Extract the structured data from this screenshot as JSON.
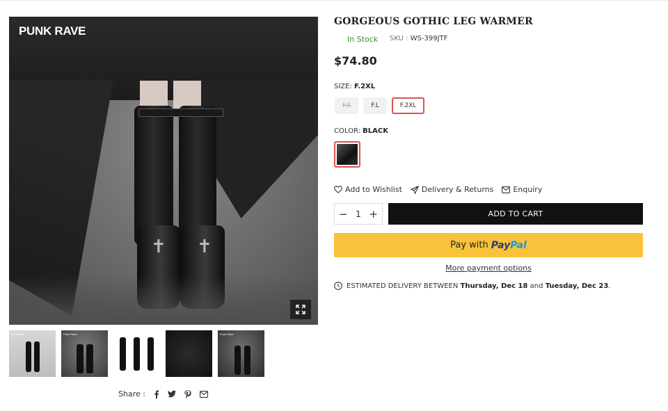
{
  "gallery": {
    "brand": "PUNK RAVE",
    "thumb_mini_labels": [
      "PunkRave",
      "Punk Rave",
      "",
      "",
      "Punk Rave"
    ]
  },
  "share": {
    "label": "Share :"
  },
  "product": {
    "title": "GORGEOUS GOTHIC LEG WARMER",
    "stock": "In Stock",
    "sku_label": "SKU :",
    "sku_value": "WS-399JTF",
    "price": "$74.80"
  },
  "size": {
    "label": "SIZE:",
    "selected": "F.2XL",
    "options": [
      {
        "label": "F.S",
        "state": "disabled"
      },
      {
        "label": "F.L",
        "state": "normal"
      },
      {
        "label": "F.2XL",
        "state": "selected"
      }
    ]
  },
  "color": {
    "label": "COLOR:",
    "selected": "BLACK"
  },
  "actions": {
    "wishlist": "Add to Wishlist",
    "delivery_returns": "Delivery & Returns",
    "enquiry": "Enquiry"
  },
  "quantity": {
    "value": "1",
    "minus": "−",
    "plus": "+"
  },
  "buttons": {
    "add_to_cart": "ADD TO CART",
    "paypal_prefix": "Pay with",
    "paypal_pay": "Pay",
    "paypal_pal": "Pal",
    "more_payment": "More payment options"
  },
  "delivery": {
    "prefix": "ESTIMATED DELIVERY BETWEEN",
    "from": "Thursday, Dec 18",
    "and": "and",
    "to": "Tuesday, Dec 23",
    "suffix": "."
  },
  "colors": {
    "accent_red": "#d9534f",
    "in_stock_green": "#3a8a2a",
    "paypal_yellow": "#f8c33a",
    "cart_black": "#111111"
  }
}
